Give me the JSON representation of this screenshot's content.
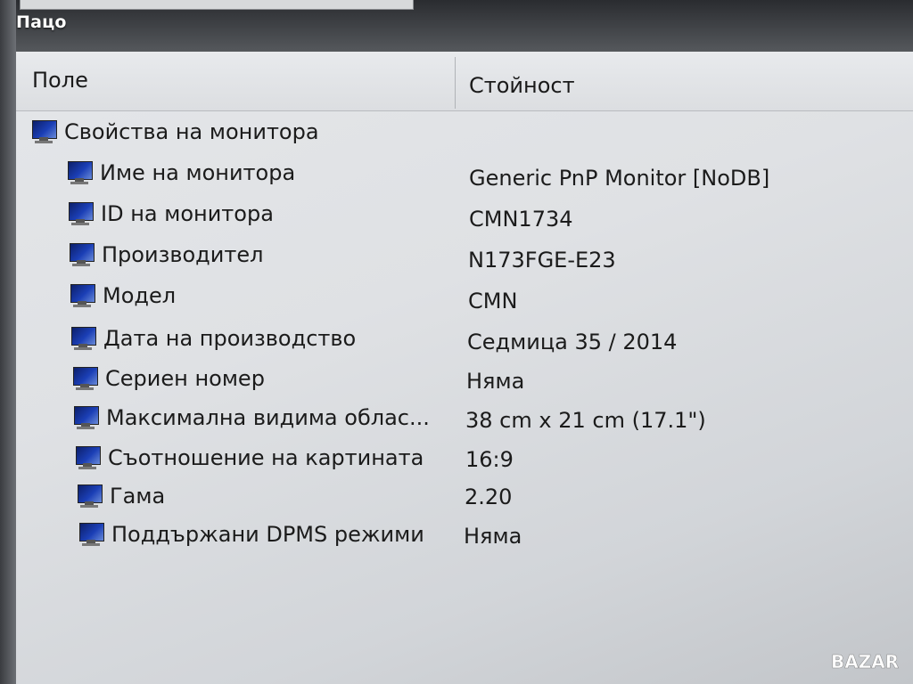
{
  "watermark": "Пацо",
  "columns": {
    "field": "Поле",
    "value": "Стойност"
  },
  "group": {
    "label": "Свойства на монитора",
    "icon": "monitor-icon"
  },
  "rows": [
    {
      "label": "Име на монитора",
      "value": "Generic PnP Monitor [NoDB]",
      "icon": "monitor-icon"
    },
    {
      "label": "ID на монитора",
      "value": "CMN1734",
      "icon": "monitor-icon"
    },
    {
      "label": "Производител",
      "value": "N173FGE-E23",
      "icon": "monitor-icon"
    },
    {
      "label": "Модел",
      "value": "CMN",
      "icon": "monitor-icon"
    },
    {
      "label": "Дата на производство",
      "value": "Седмица 35 / 2014",
      "icon": "monitor-icon"
    },
    {
      "label": "Сериен номер",
      "value": "Няма",
      "icon": "monitor-icon"
    },
    {
      "label": "Максимална видима облас...",
      "value": "38 cm x 21 cm (17.1\")",
      "icon": "monitor-icon"
    },
    {
      "label": "Съотношение на картината",
      "value": "16:9",
      "icon": "monitor-icon"
    },
    {
      "label": "Гама",
      "value": "2.20",
      "icon": "monitor-icon"
    },
    {
      "label": "Поддържани DPMS режими",
      "value": "Няма",
      "icon": "monitor-icon"
    }
  ],
  "brand_logo": "BAZAR"
}
